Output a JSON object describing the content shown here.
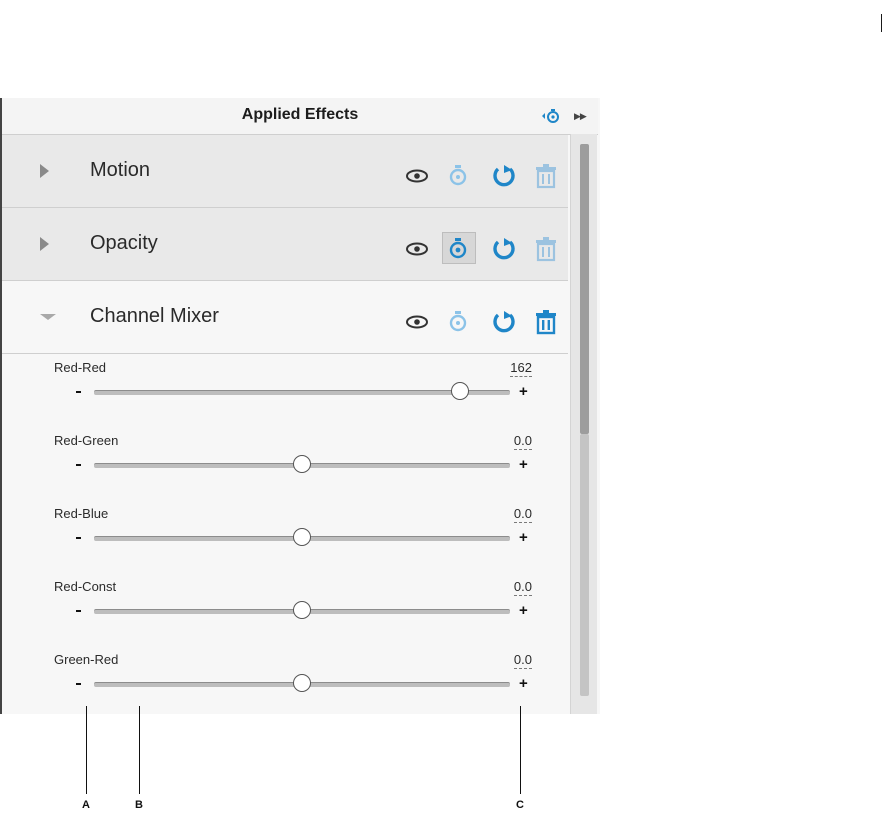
{
  "panel": {
    "title": "Applied Effects",
    "header_icons": [
      "keyframe-nav-icon",
      "fast-forward-icon"
    ]
  },
  "effects": [
    {
      "name": "Motion",
      "expanded": false,
      "stopwatch_active": false,
      "stopwatch_selected": false
    },
    {
      "name": "Opacity",
      "expanded": false,
      "stopwatch_active": true,
      "stopwatch_selected": true
    },
    {
      "name": "Channel Mixer",
      "expanded": true,
      "stopwatch_active": false,
      "stopwatch_selected": false
    }
  ],
  "params": [
    {
      "label": "Red-Red",
      "value": "162",
      "position": 0.88
    },
    {
      "label": "Red-Green",
      "value": "0.0",
      "position": 0.5
    },
    {
      "label": "Red-Blue",
      "value": "0.0",
      "position": 0.5
    },
    {
      "label": "Red-Const",
      "value": "0.0",
      "position": 0.5
    },
    {
      "label": "Green-Red",
      "value": "0.0",
      "position": 0.5
    }
  ],
  "slider": {
    "minus_label": "-",
    "plus_label": "+"
  },
  "callouts": {
    "a": "A",
    "b": "B",
    "c": "C"
  },
  "colors": {
    "accent_blue": "#1f86c8",
    "light_blue": "#7db8e0",
    "muted_trash": "#8fb9d8"
  }
}
